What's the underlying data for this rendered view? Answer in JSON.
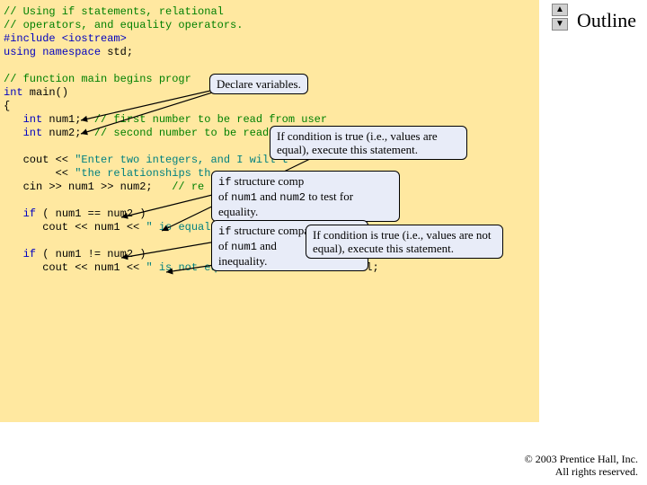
{
  "header": {
    "outline_label": "Outline"
  },
  "nav": {
    "up": "▲",
    "down": "▼"
  },
  "code": {
    "l1": "// Using if statements, relational",
    "l2": "// operators, and equality operators.",
    "l3": "#include <iostream>",
    "l4a": "using",
    "l4b": " namespace",
    "l4c": " std;",
    "l5": "",
    "l6a": "// function main begins progr",
    "l7a": "int",
    "l7b": " main()",
    "l8": "{",
    "l9a": "   int",
    "l9b": " num1;  ",
    "l9c": "// first number to be read from user",
    "l10a": "   int",
    "l10b": " num2;  ",
    "l10c": "// second number to be read fr",
    "l11": "",
    "l12a": "   cout << ",
    "l12b": "\"Enter two integers, and I will t",
    "l13a": "        << ",
    "l13b": "\"the relationships th",
    "l14a": "   cin >> num1 >> num2;   ",
    "l14b": "// re",
    "l15": "",
    "l16a": "   if",
    "l16b": " ( num1 == num2 )",
    "l17a": "      cout << num1 << ",
    "l17b": "\" is equal",
    "l18": "",
    "l19a": "   if",
    "l19b": " ( num1 != num2 )",
    "l20a": "      cout << num1 << ",
    "l20b": "\" is not equal to \"",
    "l20c": " << num2 << endl;"
  },
  "callouts": {
    "c1": "Declare variables.",
    "c2": "If condition is true (i.e., values are equal), execute this statement.",
    "c3_a": "if",
    "c3_b": " structure comp",
    "c3_c": "of ",
    "c3_d": "num1",
    "c3_e": " and ",
    "c3_f": "num2",
    "c3_g": " to test for equality.",
    "c4_a": "if",
    "c4_b": " structure compares values of ",
    "c4_c": "num1",
    "c4_d": " and ",
    "c4_e": "inequality.",
    "c5": "If condition is true (i.e., values are not equal), execute this statement."
  },
  "footer": {
    "copyright1": "© 2003 Prentice Hall, Inc.",
    "copyright2": "All rights reserved."
  }
}
